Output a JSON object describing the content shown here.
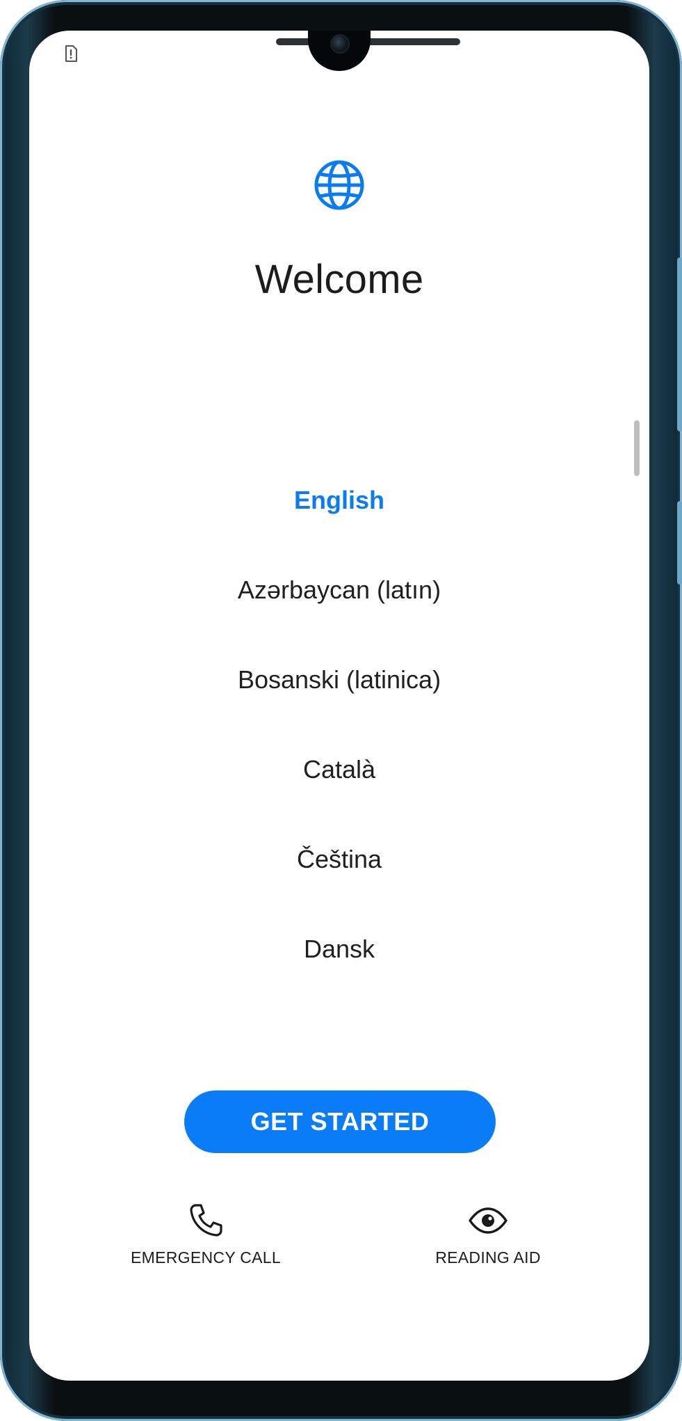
{
  "status_bar": {
    "sim_icon": "sim-card-alert-icon"
  },
  "header": {
    "icon": "globe-icon",
    "title": "Welcome"
  },
  "languages": [
    {
      "label": "English",
      "selected": true
    },
    {
      "label": "Azərbaycan (latın)",
      "selected": false
    },
    {
      "label": "Bosanski (latinica)",
      "selected": false
    },
    {
      "label": "Català",
      "selected": false
    },
    {
      "label": "Čeština",
      "selected": false
    },
    {
      "label": "Dansk",
      "selected": false
    }
  ],
  "primary_button": {
    "label": "GET STARTED"
  },
  "bottom_actions": {
    "emergency": {
      "icon": "phone-icon",
      "label": "EMERGENCY CALL"
    },
    "reading": {
      "icon": "eye-icon",
      "label": "READING AID"
    }
  },
  "colors": {
    "accent": "#0a7cf8",
    "text": "#1c1c1c"
  }
}
